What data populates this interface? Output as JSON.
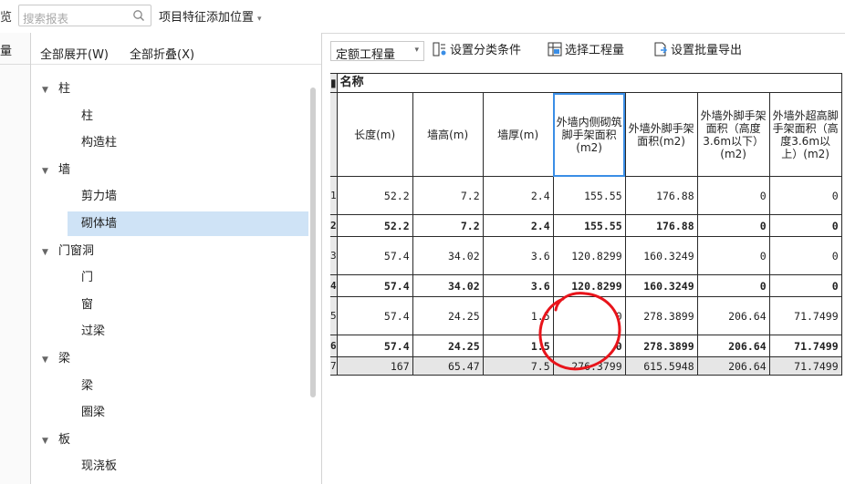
{
  "topbar": {
    "cut_left_char": "览",
    "search_placeholder": "搜索报表",
    "position_button": "项目特征添加位置"
  },
  "leftstrip": {
    "cut_char": "量"
  },
  "tree": {
    "expand_all": "全部展开(W)",
    "collapse_all": "全部折叠(X)",
    "items": [
      {
        "type": "group",
        "label": "柱"
      },
      {
        "type": "leaf",
        "label": "柱"
      },
      {
        "type": "leaf",
        "label": "构造柱"
      },
      {
        "type": "group",
        "label": "墙"
      },
      {
        "type": "leaf",
        "label": "剪力墙"
      },
      {
        "type": "leaf",
        "label": "砌体墙",
        "selected": true
      },
      {
        "type": "group",
        "label": "门窗洞"
      },
      {
        "type": "leaf",
        "label": "门"
      },
      {
        "type": "leaf",
        "label": "窗"
      },
      {
        "type": "leaf",
        "label": "过梁"
      },
      {
        "type": "group",
        "label": "梁"
      },
      {
        "type": "leaf",
        "label": "梁"
      },
      {
        "type": "leaf",
        "label": "圈梁"
      },
      {
        "type": "group",
        "label": "板"
      },
      {
        "type": "leaf",
        "label": "现浇板"
      }
    ]
  },
  "toolbar": {
    "dropdown": "定额工程量",
    "set_category": "设置分类条件",
    "select_quantity": "选择工程量",
    "batch_export": "设置批量导出"
  },
  "table": {
    "name_header": "名称",
    "columns": [
      "长度(m)",
      "墙高(m)",
      "墙厚(m)",
      "外墙内侧砌筑脚手架面积(m2)",
      "外墙外脚手架面积(m2)",
      "外墙外脚手架面积（高度3.6m以下）(m2)",
      "外墙外超高脚手架面积（高度3.6m以上）(m2)"
    ],
    "rows": [
      {
        "idx": "1",
        "bold": false,
        "values": [
          "52.2",
          "7.2",
          "2.4",
          "155.55",
          "176.88",
          "0",
          "0"
        ]
      },
      {
        "idx": "2",
        "bold": true,
        "values": [
          "52.2",
          "7.2",
          "2.4",
          "155.55",
          "176.88",
          "0",
          "0"
        ]
      },
      {
        "idx": "3",
        "bold": false,
        "values": [
          "57.4",
          "34.02",
          "3.6",
          "120.8299",
          "160.3249",
          "0",
          "0"
        ]
      },
      {
        "idx": "4",
        "bold": true,
        "values": [
          "57.4",
          "34.02",
          "3.6",
          "120.8299",
          "160.3249",
          "0",
          "0"
        ]
      },
      {
        "idx": "5",
        "bold": false,
        "values": [
          "57.4",
          "24.25",
          "1.5",
          "0",
          "278.3899",
          "206.64",
          "71.7499"
        ]
      },
      {
        "idx": "6",
        "bold": true,
        "values": [
          "57.4",
          "24.25",
          "1.5",
          "0",
          "278.3899",
          "206.64",
          "71.7499"
        ]
      },
      {
        "idx": "7",
        "bold": false,
        "sum": true,
        "values": [
          "167",
          "65.47",
          "7.5",
          "276.3799",
          "615.5948",
          "206.64",
          "71.7499"
        ]
      }
    ]
  },
  "colors": {
    "selection": "#cfe3f6",
    "focus": "#3a8ee6",
    "annotation": "#e8141b",
    "summary_row": "#e6e6e6"
  }
}
